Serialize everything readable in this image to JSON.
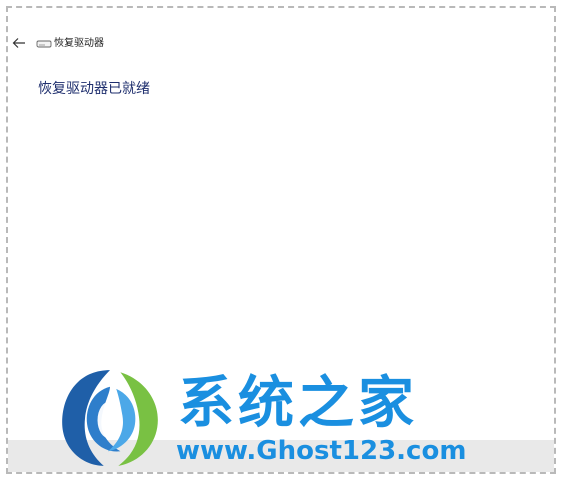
{
  "window": {
    "title": "恢复驱动器"
  },
  "page": {
    "heading": "恢复驱动器已就绪"
  },
  "watermark": {
    "text": "系统之家",
    "url": "www.Ghost123.com"
  },
  "icons": {
    "back": "arrow-left-icon",
    "drive": "drive-icon",
    "logo": "system-home-logo"
  },
  "colors": {
    "heading": "#1f2f6e",
    "watermark_blue": "#1a8fe0",
    "logo_green": "#79c143"
  }
}
